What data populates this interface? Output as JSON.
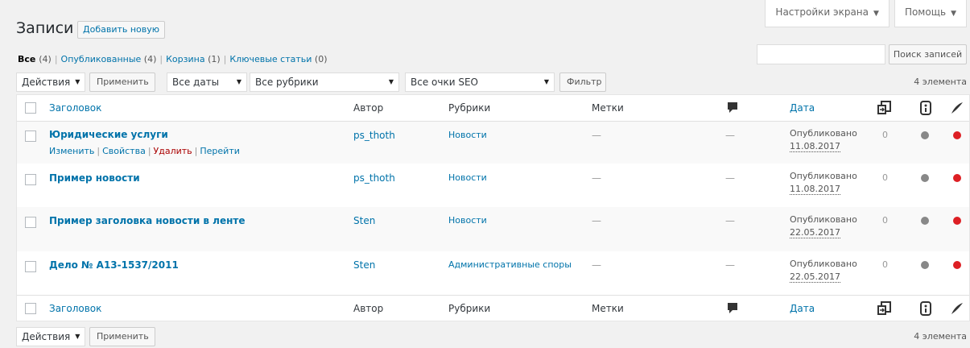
{
  "screen_options": {
    "label": "Настройки экрана"
  },
  "help": {
    "label": "Помощь"
  },
  "page": {
    "title": "Записи",
    "add_new": "Добавить новую"
  },
  "filters": {
    "all": {
      "label": "Все",
      "count": "(4)"
    },
    "published": {
      "label": "Опубликованные",
      "count": "(4)"
    },
    "trash": {
      "label": "Корзина",
      "count": "(1)"
    },
    "cornerstone": {
      "label": "Ключевые статьи",
      "count": "(0)"
    }
  },
  "search": {
    "placeholder": "",
    "button": "Поиск записей"
  },
  "top_nav": {
    "bulk_action": "Действия",
    "apply": "Применить",
    "dates": "Все даты",
    "categories": "Все рубрики",
    "seo": "Все очки SEO",
    "filter": "Фильтр",
    "count": "4 элемента"
  },
  "bottom_nav": {
    "bulk_action": "Действия",
    "apply": "Применить",
    "count": "4 элемента"
  },
  "columns": {
    "title": "Заголовок",
    "author": "Автор",
    "categories": "Рубрики",
    "tags": "Метки",
    "date": "Дата"
  },
  "row_actions": {
    "edit": "Изменить",
    "quick_edit": "Свойства",
    "trash": "Удалить",
    "view": "Перейти"
  },
  "posts": [
    {
      "title": "Юридические услуги",
      "author": "ps_thoth",
      "category": "Новости",
      "tags": "—",
      "comments": "—",
      "status": "Опубликовано",
      "date": "11.08.2017",
      "links": "0"
    },
    {
      "title": "Пример новости",
      "author": "ps_thoth",
      "category": "Новости",
      "tags": "—",
      "comments": "—",
      "status": "Опубликовано",
      "date": "11.08.2017",
      "links": "0"
    },
    {
      "title": "Пример заголовка новости в ленте",
      "author": "Sten",
      "category": "Новости",
      "tags": "—",
      "comments": "—",
      "status": "Опубликовано",
      "date": "22.05.2017",
      "links": "0"
    },
    {
      "title": "Дело № А13-1537/2011",
      "author": "Sten",
      "category": "Административные споры",
      "tags": "—",
      "comments": "—",
      "status": "Опубликовано",
      "date": "22.05.2017",
      "links": "0"
    }
  ],
  "colors": {
    "link": "#0073aa",
    "seo_dot": "#888888",
    "readability_dot": "#dd1f24"
  }
}
